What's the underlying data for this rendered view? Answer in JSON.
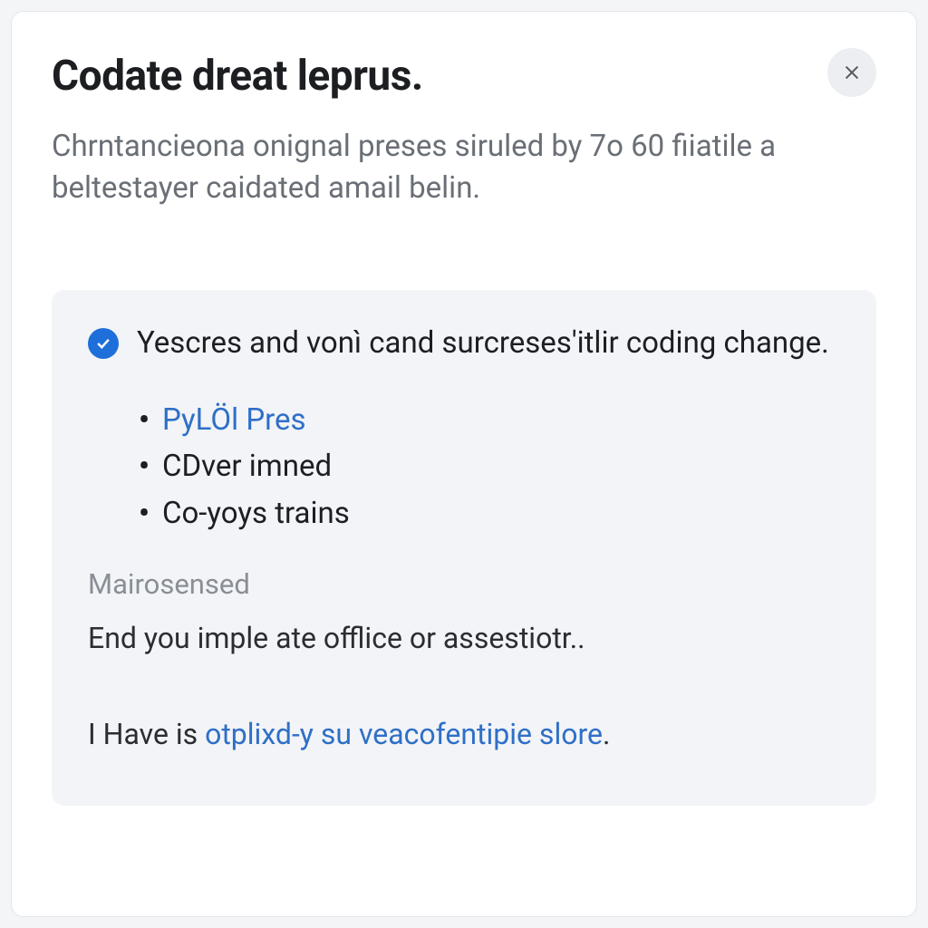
{
  "title": "Codate dreat leprus.",
  "subtitle": "Chrntancieona onignal preses siruled by 7o 60 fiiatile a beltestayer caidated amail belin.",
  "panel": {
    "status": "Yescres and vonì cand surcreses'itlir coding change.",
    "items": [
      {
        "label": "PyLÖl Pres",
        "is_link": true
      },
      {
        "label": "CDver imned",
        "is_link": false
      },
      {
        "label": "Co-yoys trains",
        "is_link": false
      }
    ],
    "section_label": "Mairosensed",
    "body": "End you imple ate offlice or assestiotr..",
    "footer_prefix": "I Have is ",
    "footer_link": "otplixd-y su veacofentipie slore",
    "footer_suffix": "."
  },
  "colors": {
    "accent": "#1e6fd9",
    "link": "#2f6fc7",
    "muted": "#8a8f96"
  }
}
